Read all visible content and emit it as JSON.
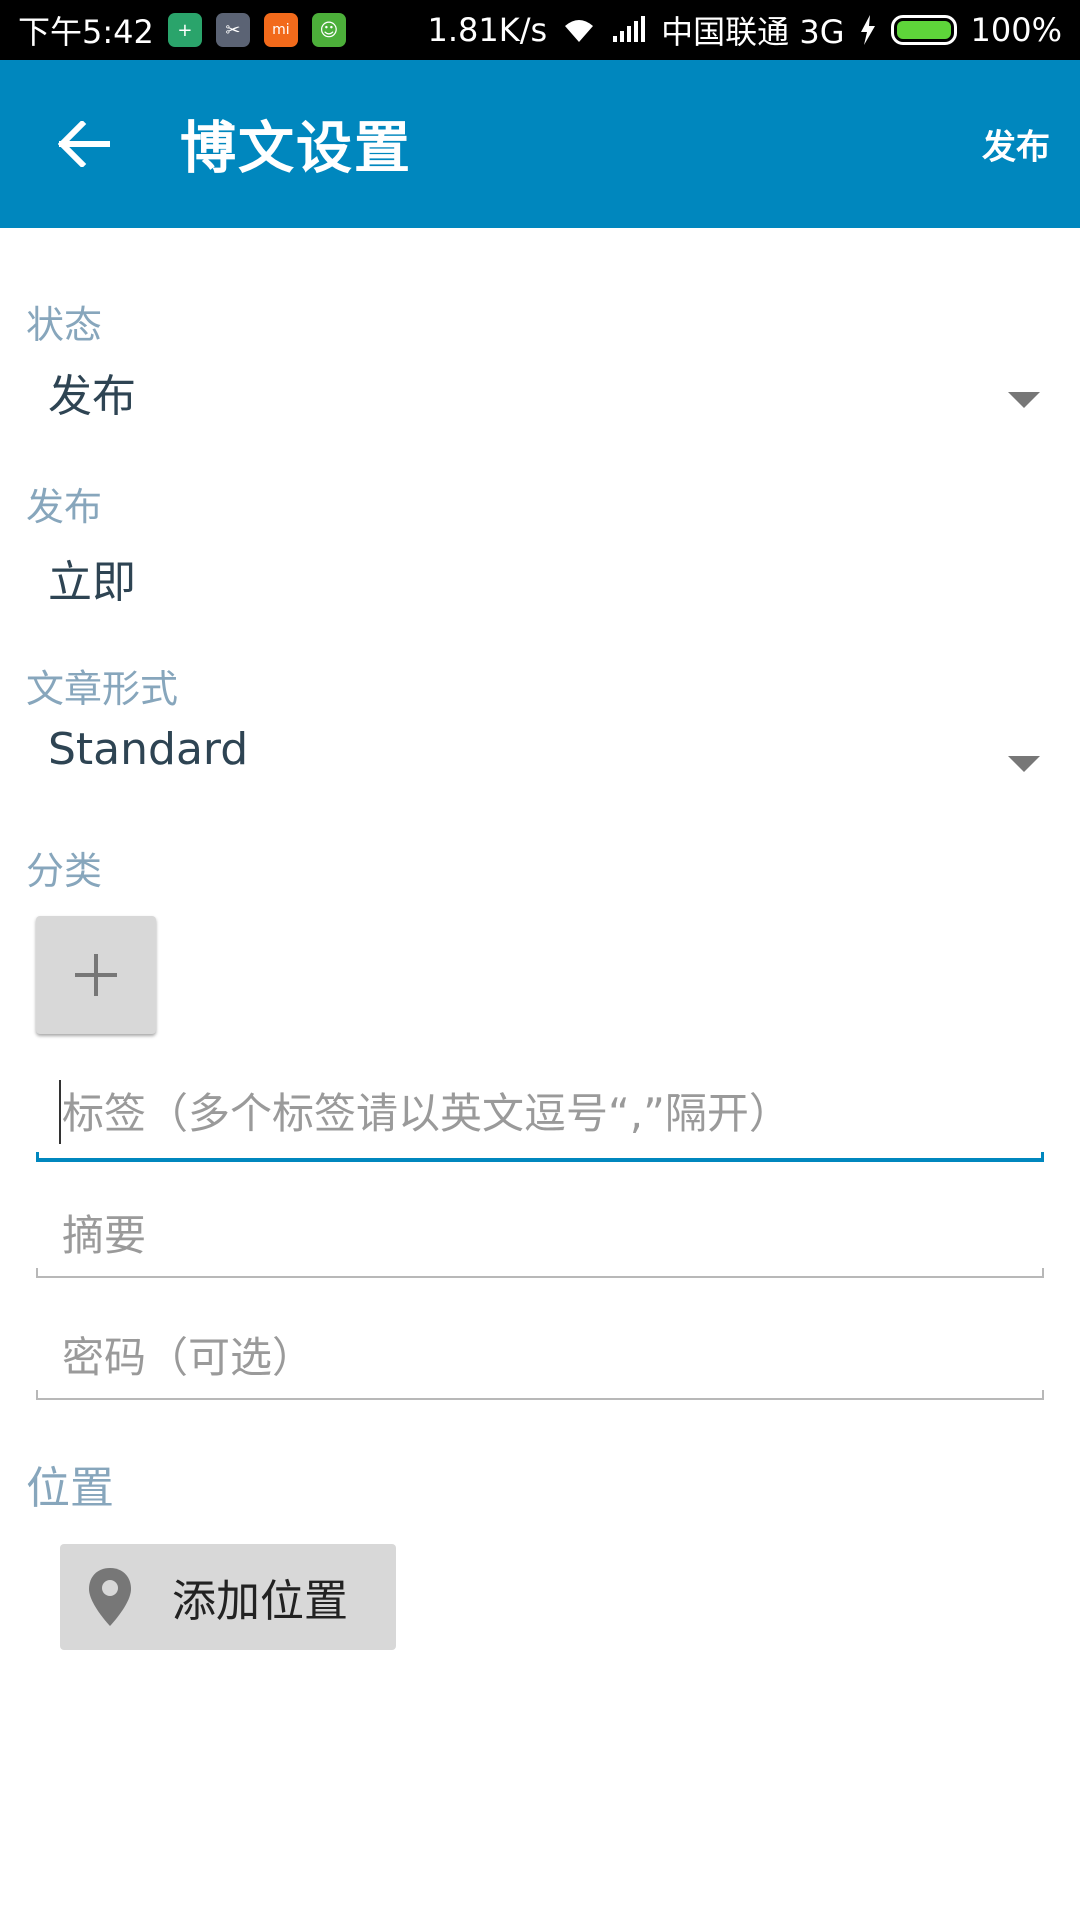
{
  "status_bar": {
    "time": "下午5:42",
    "network_speed": "1.81K/s",
    "carrier": "中国联通 3G",
    "battery": "100%",
    "battery_level": 1.0,
    "notifications": [
      {
        "icon": "shield-plus-icon",
        "color": "#2aa46b",
        "glyph": "+"
      },
      {
        "icon": "scissors-icon",
        "color": "#5b6374",
        "glyph": "✂"
      },
      {
        "icon": "mi-icon",
        "color": "#f26a1b",
        "glyph": "mi"
      },
      {
        "icon": "android-icon",
        "color": "#4caf3a",
        "glyph": "☺"
      }
    ]
  },
  "toolbar": {
    "title": "博文设置",
    "action_label": "发布",
    "color": "#0087be"
  },
  "form": {
    "status": {
      "label": "状态",
      "value": "发布"
    },
    "publish": {
      "label": "发布",
      "value": "立即"
    },
    "post_format": {
      "label": "文章形式",
      "value": "Standard"
    },
    "categories": {
      "label": "分类"
    },
    "tags": {
      "placeholder": "标签（多个标签请以英文逗号“,”隔开）"
    },
    "excerpt": {
      "placeholder": "摘要"
    },
    "password": {
      "placeholder": "密码（可选）"
    },
    "location": {
      "label": "位置",
      "button_label": "添加位置"
    }
  },
  "colors": {
    "label": "#87a6bc",
    "value": "#2e4453",
    "accent": "#0087be",
    "button_bg": "#d8d8d8"
  }
}
